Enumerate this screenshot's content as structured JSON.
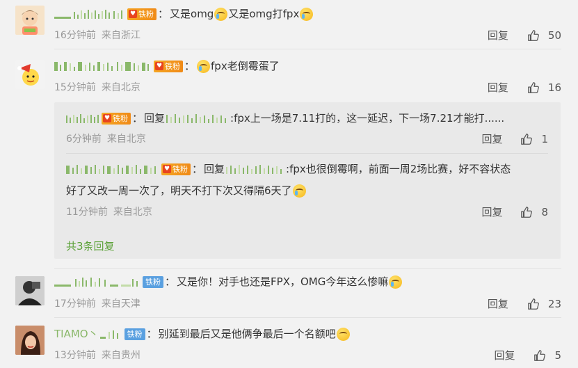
{
  "colors": {
    "accent_green": "#5ba137",
    "fan_badge": "#f5a623",
    "iron_badge": "#5aa0e0",
    "meta_gray": "#999999"
  },
  "reply_label": "回复",
  "comments": [
    {
      "badge": "铁粉",
      "text": "又是omg",
      "text2": "又是omg打fpx",
      "time": "16分钟前",
      "location": "来自浙江",
      "likes": "50"
    },
    {
      "badge": "铁粉",
      "text": "fpx老倒霉蛋了",
      "time": "15分钟前",
      "location": "来自北京",
      "likes": "16"
    },
    {
      "badge": "铁粉",
      "text": "又是你！对手也还是FPX，OMG今年这么惨嘛",
      "time": "17分钟前",
      "location": "来自天津",
      "likes": "23"
    },
    {
      "badge": "铁粉",
      "text": "别延到最后又是他俩争最后一个名额吧",
      "time": "13分钟前",
      "location": "来自贵州",
      "likes": "5"
    }
  ],
  "replies": [
    {
      "badge": "铁粉",
      "prefix": "回复",
      "text": ":fpx上一场是7.11打的，这一延迟，下一场7.21才能打......",
      "time": "6分钟前",
      "location": "来自北京",
      "likes": "1"
    },
    {
      "badge": "铁粉",
      "prefix": "回复",
      "text": ":fpx也很倒霉啊，前面一周2场比赛，好不容状态",
      "text2": "好了又改一周一次了，明天不打下次又得隔6天了",
      "time": "11分钟前",
      "location": "来自北京",
      "likes": "8"
    }
  ],
  "total_replies": "共3条回复",
  "first_name_fragment": "TIAMO丶"
}
